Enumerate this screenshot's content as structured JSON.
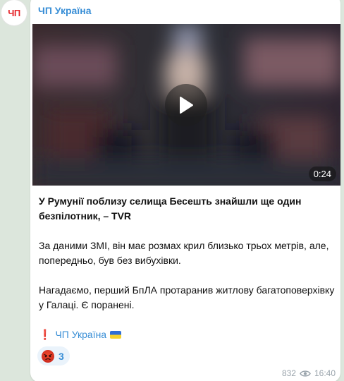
{
  "channel": {
    "avatar_text": "ЧП",
    "name": "ЧП Україна"
  },
  "video": {
    "duration": "0:24"
  },
  "message": {
    "headline": "У Румунії поблизу селища Бесешть знайшли ще один безпілотник, – TVR",
    "paragraph1": "За даними ЗМІ, він має розмах крил близько трьох метрів, але, попередньо, був без вибухівки.",
    "paragraph2": "Нагадаємо, перший БпЛА протаранив житлову багатоповерхівку у Галаці. Є поранені.",
    "signature_mark": "❗",
    "signature_name": "ЧП Україна",
    "signature_flag_icon": "ukraine-flag-icon"
  },
  "reaction": {
    "emoji_icon": "angry-face-icon",
    "count": "3"
  },
  "footer": {
    "views": "832",
    "views_icon": "eye-icon",
    "time": "16:40"
  },
  "colors": {
    "accent": "#3a8fd6",
    "brand_red": "#e5262b",
    "background": "#dce6dc"
  }
}
